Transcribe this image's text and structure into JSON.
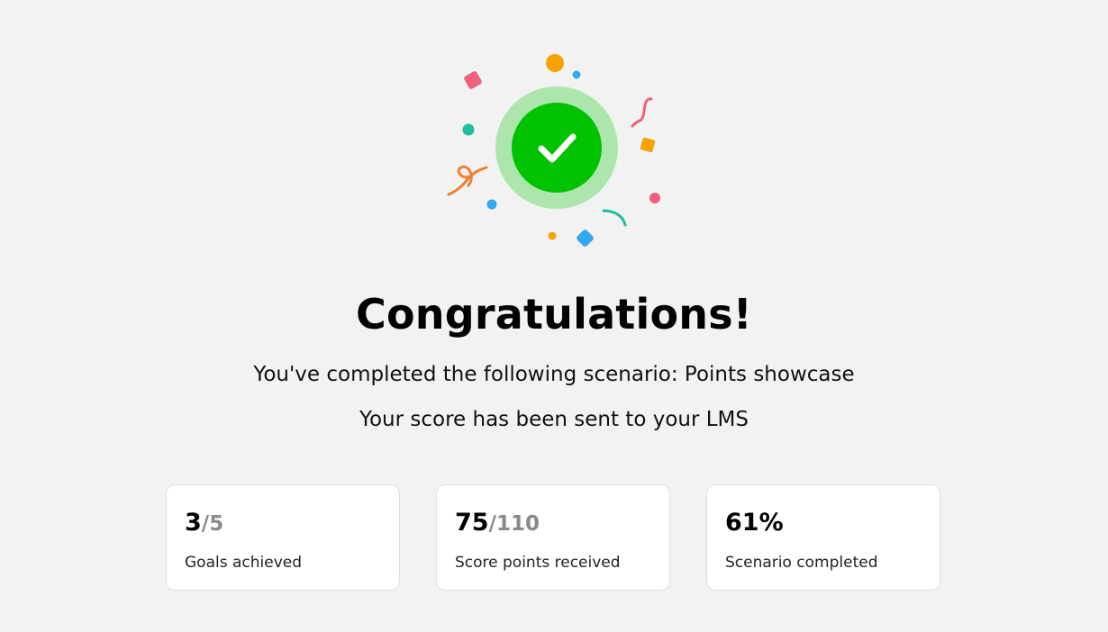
{
  "completion": {
    "title": "Congratulations!",
    "scenario_line": "You've completed the following scenario: Points showcase",
    "lms_line": "Your score has been sent to your LMS"
  },
  "stats": [
    {
      "value": "3",
      "total": "/5",
      "label": "Goals achieved"
    },
    {
      "value": "75",
      "total": "/110",
      "label": "Score points received"
    },
    {
      "value": "61%",
      "total": "",
      "label": "Scenario completed"
    }
  ],
  "colors": {
    "success_green": "#00c200",
    "success_ring": "#ade6ad",
    "background": "#f2f2f2"
  },
  "icons": {
    "success": "check-circle-icon",
    "confetti": "confetti-icon"
  }
}
